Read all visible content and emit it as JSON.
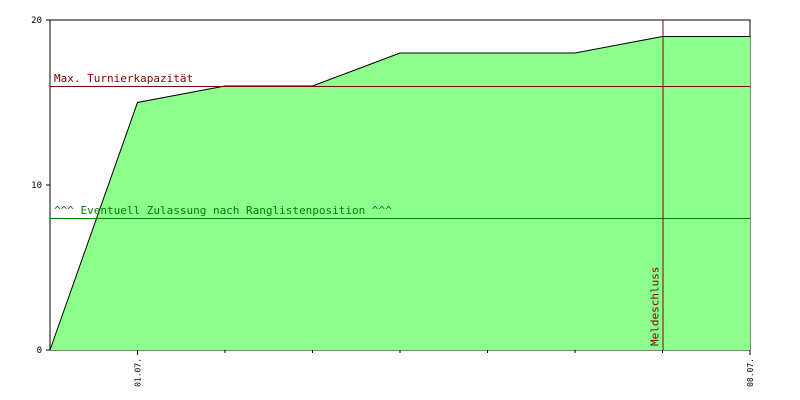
{
  "chart_data": {
    "type": "area",
    "title": "",
    "xlabel": "",
    "ylabel": "",
    "ylim": [
      0,
      20
    ],
    "y_ticks": [
      "0",
      "10",
      "20"
    ],
    "x_tick_labels": [
      {
        "x": 1,
        "label": "01.07."
      },
      {
        "x": 8,
        "label": "08.07."
      }
    ],
    "minor_x_ticks": [
      2,
      3,
      4,
      5,
      6,
      7
    ],
    "series": [
      {
        "x": [
          0,
          1,
          2,
          3,
          4,
          5,
          6,
          7,
          8
        ],
        "values": [
          0,
          15,
          16,
          16,
          18,
          18,
          18,
          19,
          19
        ]
      }
    ],
    "xlim": [
      0,
      8
    ],
    "colors": {
      "area_fill": "#8cff8c",
      "series_line": "#000000",
      "capacity_line": "#800000",
      "ranking_line": "#008000",
      "deadline_line": "#800000",
      "axis": "#000000"
    },
    "reference_lines": {
      "capacity": {
        "y": 16,
        "label": "Max. Turnierkapazität"
      },
      "ranking": {
        "y": 8,
        "label": "^^^ Eventuell Zulassung nach Ranglistenposition ^^^"
      },
      "deadline": {
        "x": 7,
        "label": "Meldeschluss"
      }
    },
    "grid": false
  }
}
